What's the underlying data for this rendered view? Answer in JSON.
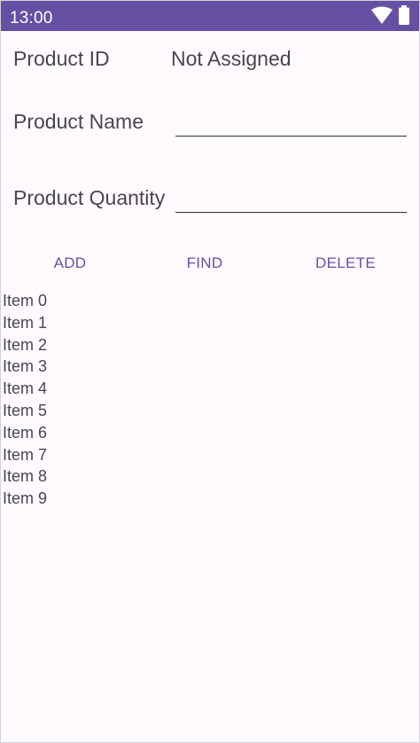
{
  "status_bar": {
    "time": "13:00",
    "icons": [
      "wifi-icon",
      "battery-icon"
    ],
    "color": "#6650a4"
  },
  "form": {
    "product_id": {
      "label": "Product ID",
      "value": "Not Assigned"
    },
    "product_name": {
      "label": "Product Name",
      "value": ""
    },
    "product_quantity": {
      "label": "Product Quantity",
      "value": ""
    }
  },
  "actions": {
    "add": "ADD",
    "find": "FIND",
    "delete": "DELETE"
  },
  "list": {
    "items": [
      "Item 0",
      "Item 1",
      "Item 2",
      "Item 3",
      "Item 4",
      "Item 5",
      "Item 6",
      "Item 7",
      "Item 8",
      "Item 9"
    ]
  },
  "colors": {
    "accent": "#6650a4",
    "text": "#49454f",
    "background": "#fffbfe"
  }
}
